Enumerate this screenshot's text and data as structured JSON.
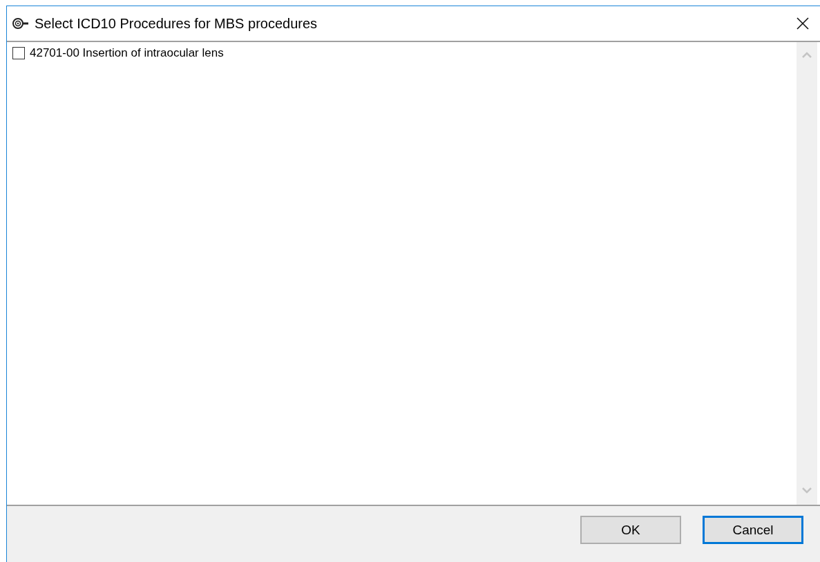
{
  "window": {
    "title": "Select ICD10 Procedures for MBS procedures"
  },
  "items": [
    {
      "label": "42701-00 Insertion of intraocular lens",
      "checked": false
    }
  ],
  "buttons": [
    {
      "label": "OK",
      "focused": false
    },
    {
      "label": "Cancel",
      "focused": true
    }
  ]
}
